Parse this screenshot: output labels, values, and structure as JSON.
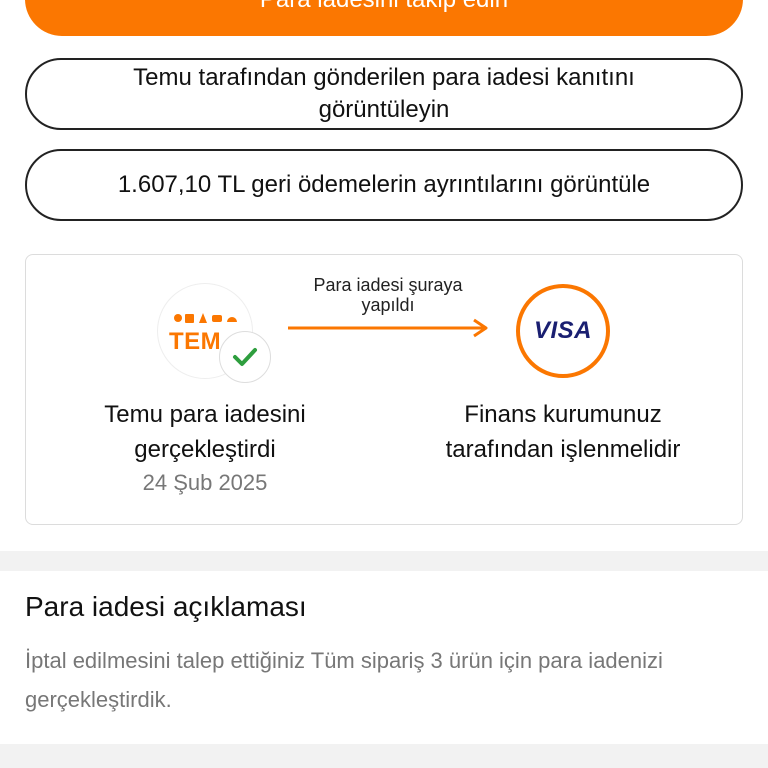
{
  "actions": {
    "track_refund_label": "Para iadesini takip edin",
    "view_proof_label": "Temu tarafından gönderilen para iadesi kanıtını görüntüleyin",
    "view_details_label": "1.607,10 TL geri ödemelerin ayrıntılarını görüntüle"
  },
  "refund_flow": {
    "sender_logo": {
      "icons": "🛍️✂️",
      "wordmark": "TEMU",
      "icon": "temu-logo"
    },
    "sender_status_icon": "check-icon",
    "arrow_label": "Para iadesi şuraya yapıldı",
    "receiver_logo": "VISA",
    "sender_caption": "Temu para iadesini gerçekleştirdi",
    "sender_date": "24 Şub 2025",
    "receiver_caption": "Finans kurumunuz tarafından işlenmelidir"
  },
  "explanation": {
    "title": "Para iadesi açıklaması",
    "body": "İptal edilmesini talep ettiğiniz Tüm sipariş 3 ürün için para iadenizi gerçekleştirdik."
  },
  "colors": {
    "accent": "#fb7701",
    "check": "#2e9e3e",
    "visa": "#1a1f71",
    "muted_text": "#777777"
  }
}
